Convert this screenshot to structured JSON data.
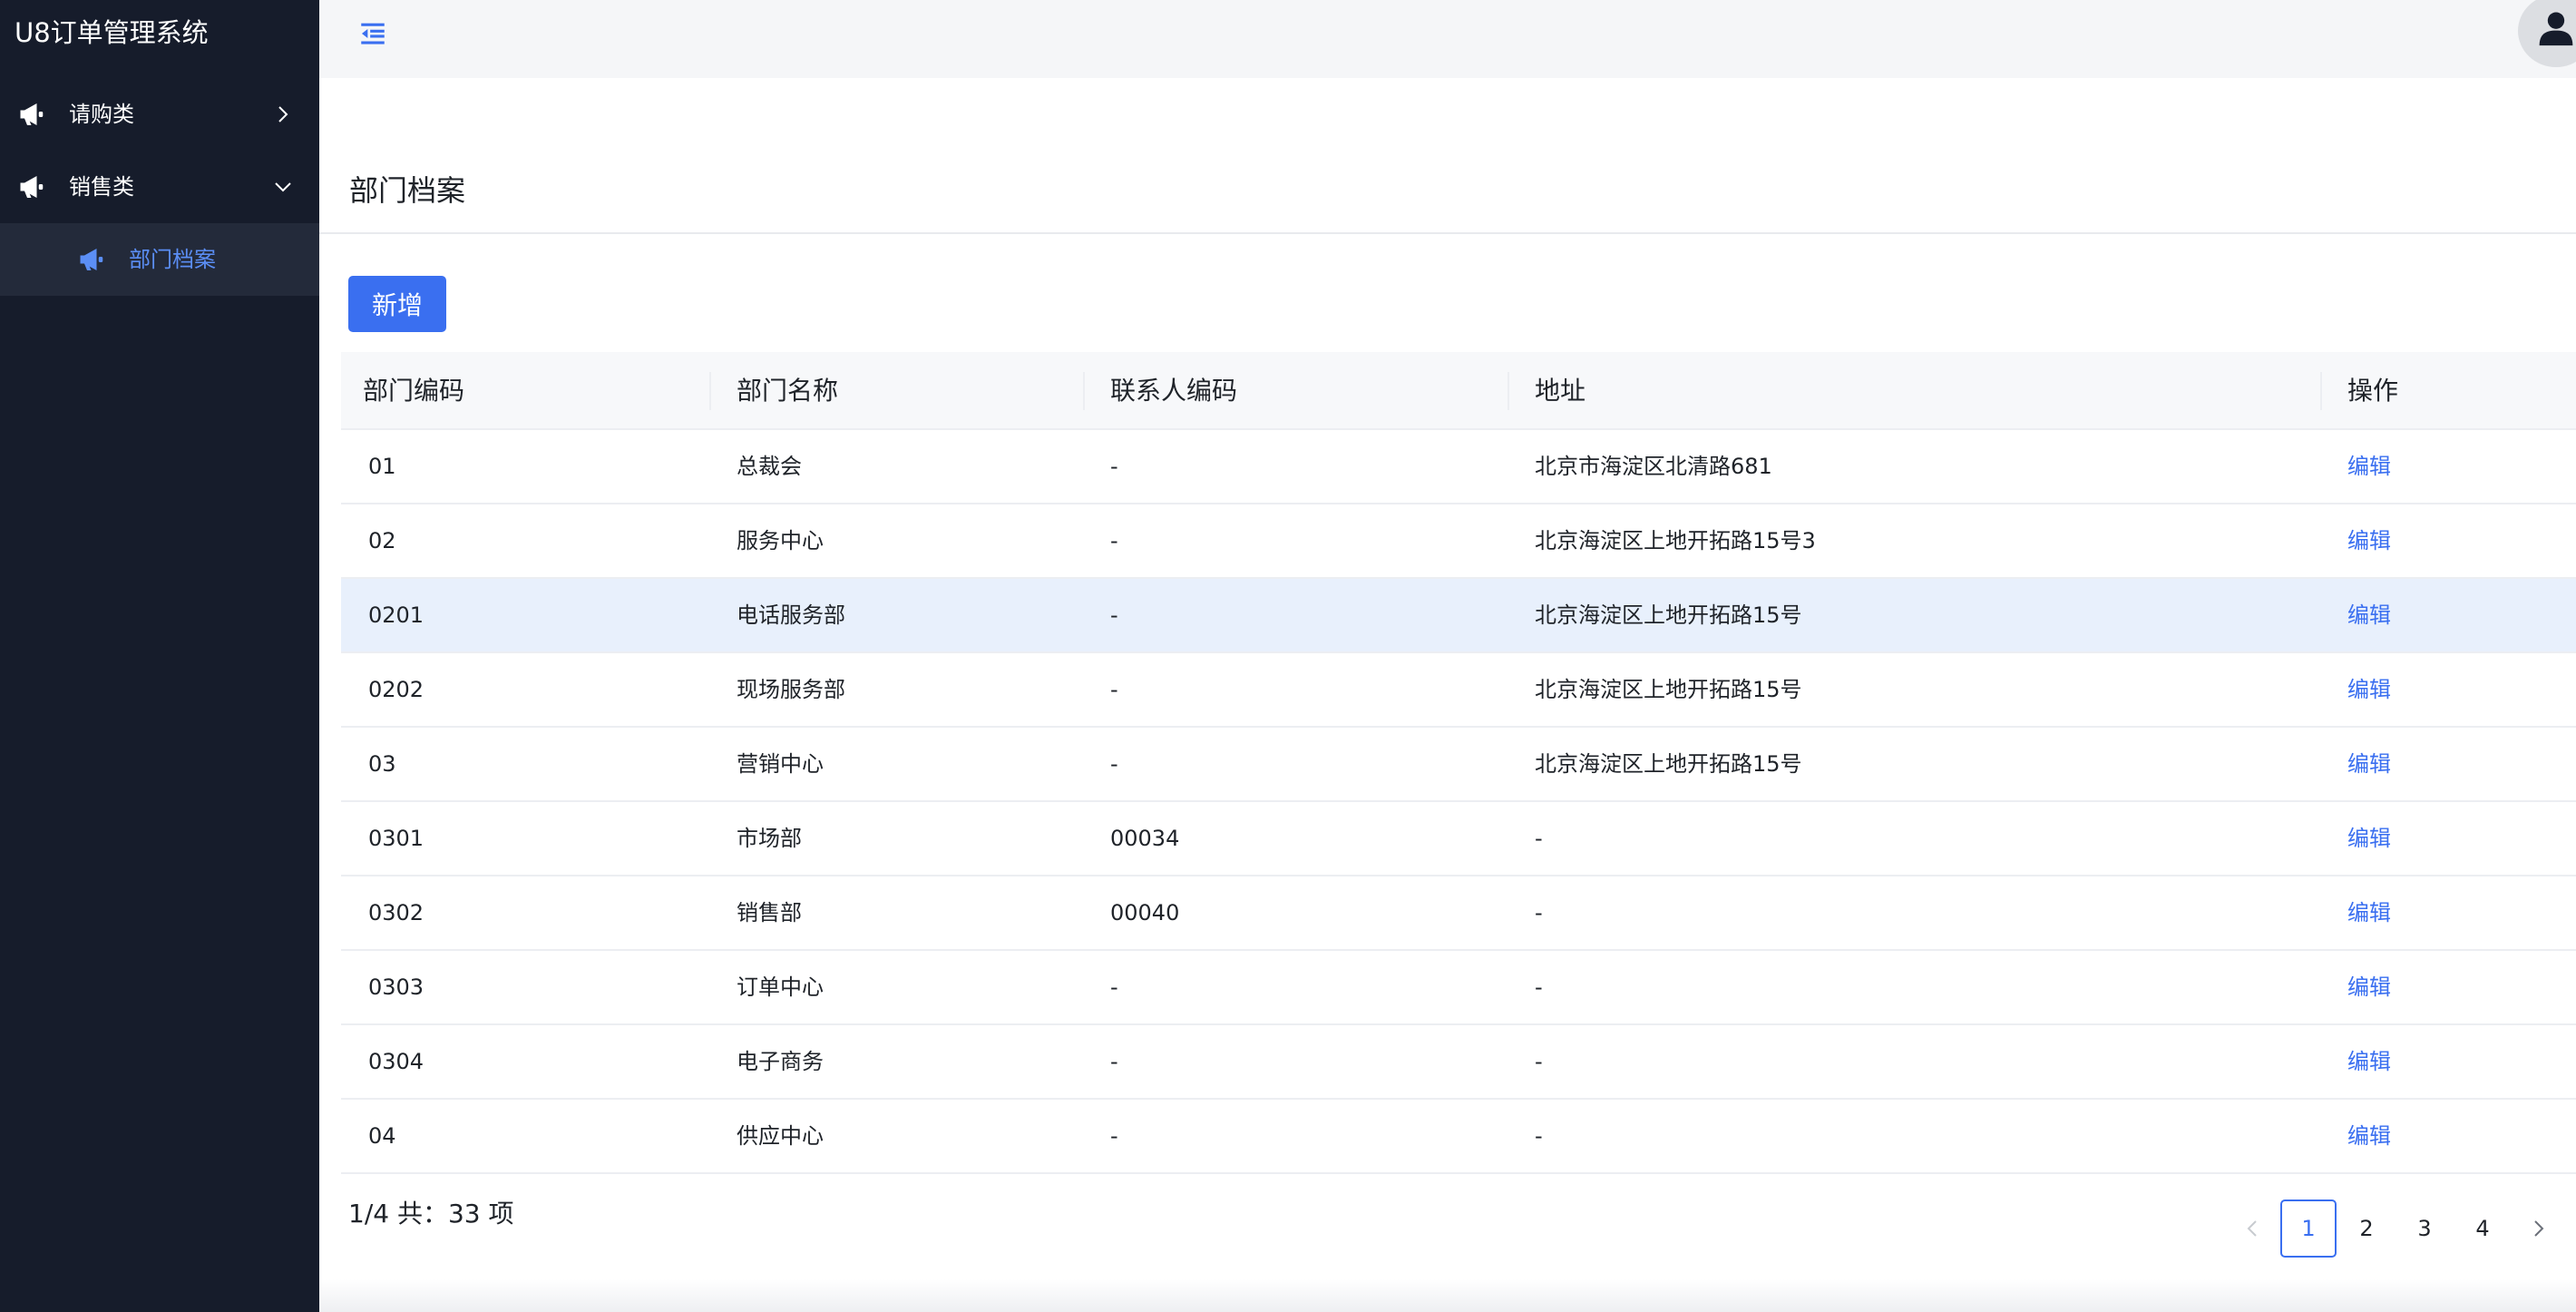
{
  "app": {
    "title": "U8订单管理系统"
  },
  "sidebar": {
    "items": [
      {
        "label": "请购类",
        "icon": "megaphone-icon",
        "expanded": false
      },
      {
        "label": "销售类",
        "icon": "megaphone-icon",
        "expanded": true
      },
      {
        "label": "部门档案",
        "icon": "megaphone-icon",
        "active": true
      }
    ]
  },
  "page": {
    "title": "部门档案",
    "add_label": "新增"
  },
  "table": {
    "headers": [
      "部门编码",
      "部门名称",
      "联系人编码",
      "地址",
      "操作"
    ],
    "rows": [
      {
        "code": "01",
        "name": "总裁会",
        "contact": "-",
        "address": "北京市海淀区北清路681",
        "action": "编辑"
      },
      {
        "code": "02",
        "name": "服务中心",
        "contact": "-",
        "address": "北京海淀区上地开拓路15号3",
        "action": "编辑"
      },
      {
        "code": "0201",
        "name": "电话服务部",
        "contact": "-",
        "address": "北京海淀区上地开拓路15号",
        "action": "编辑"
      },
      {
        "code": "0202",
        "name": "现场服务部",
        "contact": "-",
        "address": "北京海淀区上地开拓路15号",
        "action": "编辑"
      },
      {
        "code": "03",
        "name": "营销中心",
        "contact": "-",
        "address": "北京海淀区上地开拓路15号",
        "action": "编辑"
      },
      {
        "code": "0301",
        "name": "市场部",
        "contact": "00034",
        "address": "-",
        "action": "编辑"
      },
      {
        "code": "0302",
        "name": "销售部",
        "contact": "00040",
        "address": "-",
        "action": "编辑"
      },
      {
        "code": "0303",
        "name": "订单中心",
        "contact": "-",
        "address": "-",
        "action": "编辑"
      },
      {
        "code": "0304",
        "name": "电子商务",
        "contact": "-",
        "address": "-",
        "action": "编辑"
      },
      {
        "code": "04",
        "name": "供应中心",
        "contact": "-",
        "address": "-",
        "action": "编辑"
      }
    ]
  },
  "pagination": {
    "summary": "1/4 共：33 项",
    "pages": [
      "1",
      "2",
      "3",
      "4"
    ],
    "current": "1"
  },
  "colors": {
    "sidebar_bg": "#161c2b",
    "accent": "#3a6ff0",
    "highlight_row": "#e8f0fc"
  }
}
